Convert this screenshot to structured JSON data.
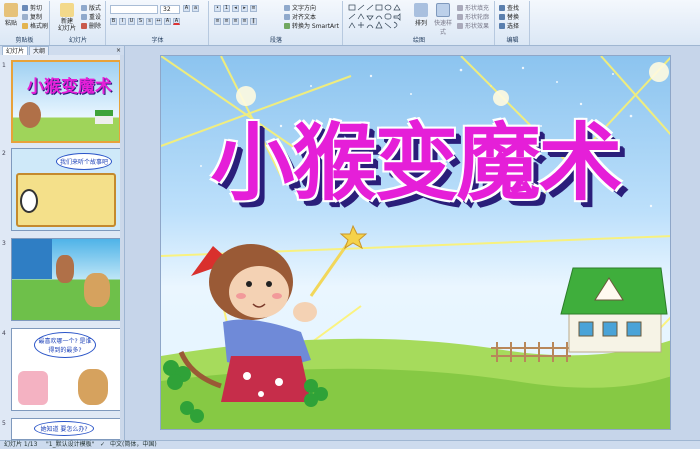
{
  "ribbon": {
    "clipboard": {
      "label": "剪贴板",
      "paste": "粘贴",
      "cut": "剪切",
      "copy": "复制",
      "format_painter": "格式刷"
    },
    "slides": {
      "label": "幻灯片",
      "new_slide": "新建\n幻灯片",
      "layout": "版式",
      "reset": "重设",
      "delete": "删除"
    },
    "font": {
      "label": "字体",
      "size": "32"
    },
    "paragraph": {
      "label": "段落",
      "text_direction": "文字方向",
      "align_text": "对齐文本",
      "smartart": "转换为 SmartArt"
    },
    "drawing": {
      "label": "绘图",
      "arrange": "排列",
      "quick_styles": "快速样式",
      "fill": "形状填充",
      "outline": "形状轮廓",
      "effects": "形状效果"
    },
    "editing": {
      "label": "编辑",
      "find": "查找",
      "replace": "替换",
      "select": "选择"
    }
  },
  "pane": {
    "tabs": [
      "幻灯片",
      "大纲"
    ],
    "close": "×"
  },
  "thumbs": [
    {
      "num": "1",
      "title": "小猴变魔术"
    },
    {
      "num": "2",
      "bubble": "我们来听个故事吧"
    },
    {
      "num": "3"
    },
    {
      "num": "4",
      "bubble": "最喜欢哪一个? 是谁得到的最多?"
    },
    {
      "num": "5",
      "bubble": "她知道 要怎么办?"
    }
  ],
  "slide": {
    "title": "小猴变魔术"
  },
  "status": {
    "slide_count": "幻灯片 1/13",
    "theme": "\"1_默认设计模板\"",
    "language": "中文(简体，中国)"
  },
  "colors": {
    "title": "#e51fd8",
    "title_shadow": "#2a1e7a",
    "sky": "#8cc4ef",
    "grass": "#8fd14a"
  }
}
